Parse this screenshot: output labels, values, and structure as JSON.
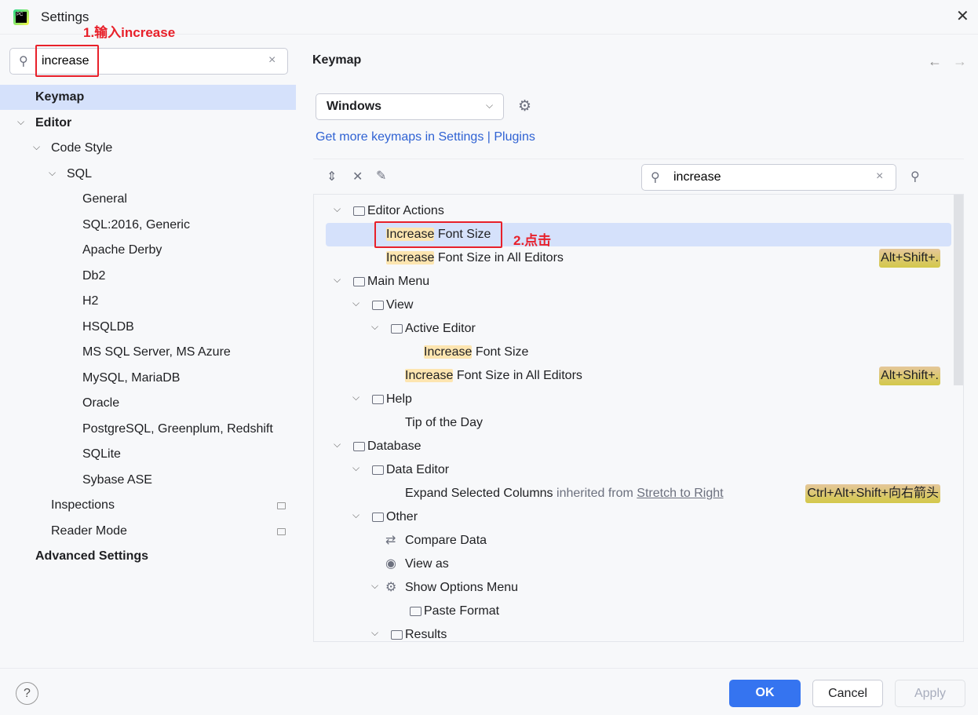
{
  "window": {
    "title": "Settings",
    "close_icon": "close-icon"
  },
  "annotations": {
    "step1": "1.输入increase",
    "step2": "2.点击"
  },
  "sidebar": {
    "search_value": "increase",
    "items": [
      {
        "label": "Keymap",
        "level": 0,
        "bold": true,
        "selected": true
      },
      {
        "label": "Editor",
        "level": 0,
        "bold": true,
        "expanded": true
      },
      {
        "label": "Code Style",
        "level": 1,
        "expanded": true
      },
      {
        "label": "SQL",
        "level": 2,
        "expanded": true
      },
      {
        "label": "General",
        "level": 3
      },
      {
        "label": "SQL:2016, Generic",
        "level": 3
      },
      {
        "label": "Apache Derby",
        "level": 3
      },
      {
        "label": "Db2",
        "level": 3
      },
      {
        "label": "H2",
        "level": 3
      },
      {
        "label": "HSQLDB",
        "level": 3
      },
      {
        "label": "MS SQL Server, MS Azure",
        "level": 3
      },
      {
        "label": "MySQL, MariaDB",
        "level": 3
      },
      {
        "label": "Oracle",
        "level": 3
      },
      {
        "label": "PostgreSQL, Greenplum, Redshift",
        "level": 3
      },
      {
        "label": "SQLite",
        "level": 3
      },
      {
        "label": "Sybase ASE",
        "level": 3
      },
      {
        "label": "Inspections",
        "level": 1,
        "badge": true
      },
      {
        "label": "Reader Mode",
        "level": 1,
        "badge": true
      },
      {
        "label": "Advanced Settings",
        "level": 0,
        "bold": true
      }
    ]
  },
  "main": {
    "title": "Keymap",
    "keymap_select": "Windows",
    "get_more": "Get more keymaps in Settings | Plugins",
    "search_value": "increase",
    "tree": [
      {
        "level": 0,
        "type": "folder",
        "parts": [
          {
            "t": "Editor Actions"
          }
        ]
      },
      {
        "level": 1,
        "type": "leaf",
        "selected": true,
        "parts": [
          {
            "t": "Increase",
            "hl": true
          },
          {
            "t": " Font Size"
          }
        ]
      },
      {
        "level": 1,
        "type": "leaf",
        "parts": [
          {
            "t": "Increase",
            "hl": true
          },
          {
            "t": " Font Size in All Editors"
          }
        ],
        "shortcut": "Alt+Shift+."
      },
      {
        "level": 0,
        "type": "folder",
        "parts": [
          {
            "t": "Main Menu"
          }
        ]
      },
      {
        "level": 1,
        "type": "folder",
        "parts": [
          {
            "t": "View"
          }
        ]
      },
      {
        "level": 2,
        "type": "folder",
        "parts": [
          {
            "t": "Active Editor"
          }
        ]
      },
      {
        "level": 3,
        "type": "leaf",
        "parts": [
          {
            "t": "Increase",
            "hl": true
          },
          {
            "t": " Font Size"
          }
        ]
      },
      {
        "level": 2,
        "type": "leaf",
        "parts": [
          {
            "t": "Increase",
            "hl": true
          },
          {
            "t": " Font Size in All Editors"
          }
        ],
        "shortcut": "Alt+Shift+."
      },
      {
        "level": 1,
        "type": "folder",
        "parts": [
          {
            "t": "Help"
          }
        ]
      },
      {
        "level": 2,
        "type": "leaf",
        "parts": [
          {
            "t": "Tip of the Day"
          }
        ]
      },
      {
        "level": 0,
        "type": "folder",
        "parts": [
          {
            "t": "Database"
          }
        ]
      },
      {
        "level": 1,
        "type": "folder",
        "parts": [
          {
            "t": "Data Editor"
          }
        ]
      },
      {
        "level": 2,
        "type": "leaf",
        "parts": [
          {
            "t": "Expand Selected Columns"
          },
          {
            "t": " inherited from ",
            "dim": true
          },
          {
            "t": "Stretch to Right",
            "link": true
          }
        ],
        "shortcut": "Ctrl+Alt+Shift+向右箭头"
      },
      {
        "level": 1,
        "type": "folder",
        "parts": [
          {
            "t": "Other"
          }
        ]
      },
      {
        "level": 2,
        "type": "leaf",
        "icon": "compare-icon",
        "parts": [
          {
            "t": "Compare Data"
          }
        ]
      },
      {
        "level": 2,
        "type": "leaf",
        "icon": "eye-icon",
        "parts": [
          {
            "t": "View as"
          }
        ]
      },
      {
        "level": 2,
        "type": "folder",
        "icon": "gear-icon",
        "parts": [
          {
            "t": "Show Options Menu"
          }
        ]
      },
      {
        "level": 3,
        "type": "leaf",
        "icon": "folder-icon",
        "parts": [
          {
            "t": "Paste Format"
          }
        ]
      },
      {
        "level": 2,
        "type": "folder",
        "parts": [
          {
            "t": "Results"
          }
        ]
      }
    ]
  },
  "footer": {
    "help": "?",
    "ok": "OK",
    "cancel": "Cancel",
    "apply": "Apply"
  },
  "colors": {
    "accent": "#3574f0",
    "selection": "#d5e1fb",
    "annotation": "#e8202a",
    "match_highlight": "#fde5b0"
  }
}
